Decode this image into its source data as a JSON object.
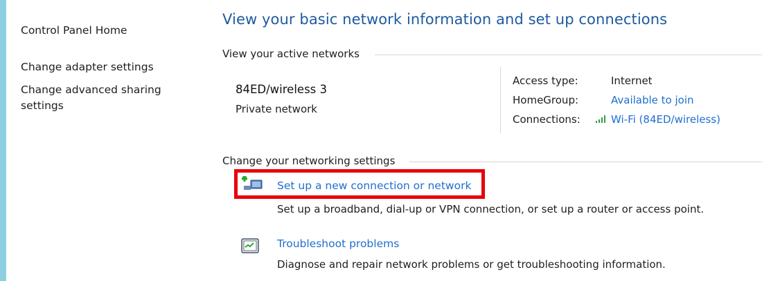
{
  "sidebar": {
    "home_label": "Control Panel Home",
    "items": [
      {
        "label": "Change adapter settings"
      },
      {
        "label": "Change advanced sharing"
      },
      {
        "label": "settings"
      }
    ]
  },
  "main": {
    "title": "View your basic network information and set up connections",
    "active_networks_heading": "View your active networks",
    "network": {
      "name": "84ED/wireless  3",
      "category": "Private network"
    },
    "properties": {
      "access_type_label": "Access type:",
      "access_type_value": "Internet",
      "homegroup_label": "HomeGroup:",
      "homegroup_value": "Available to join",
      "connections_label": "Connections:",
      "connections_value": "Wi-Fi (84ED/wireless)"
    },
    "settings_heading": "Change your networking settings",
    "tasks": [
      {
        "label": "Set up a new connection or network",
        "description": "Set up a broadband, dial-up or VPN connection, or set up a router or access point.",
        "icon": "new-connection-icon"
      },
      {
        "label": "Troubleshoot problems",
        "description": "Diagnose and repair network problems or get troubleshooting information.",
        "icon": "troubleshoot-icon"
      }
    ]
  },
  "colors": {
    "link": "#1e6fd0",
    "title": "#1e5aa0",
    "highlight": "#e8000b",
    "frame": "#8dd0e2",
    "signal": "#2ea043"
  }
}
